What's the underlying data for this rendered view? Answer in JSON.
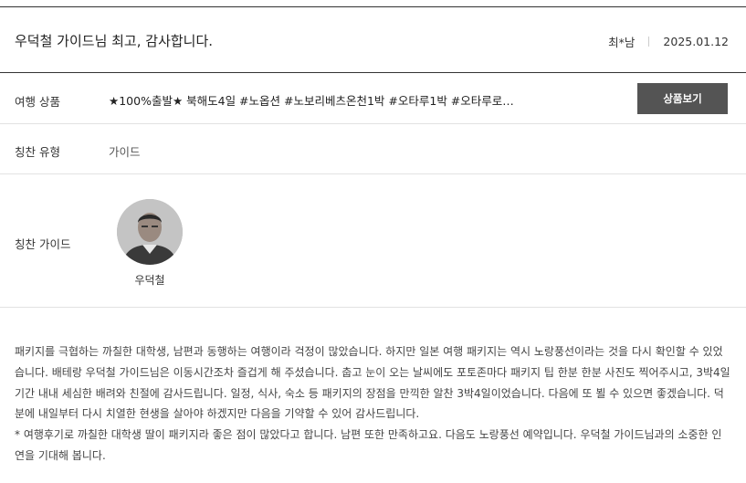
{
  "header": {
    "title": "우덕철 가이드님 최고, 감사합니다.",
    "author": "최*남",
    "date": "2025.01.12"
  },
  "product": {
    "label": "여행 상품",
    "value": "★100%출발★ 북해도4일 #노옵션 #노보리베츠온천1박 #오타루1박 #오타루로프...",
    "button_label": "상품보기"
  },
  "praise_type": {
    "label": "칭찬 유형",
    "value": "가이드"
  },
  "praise_guide": {
    "label": "칭찬 가이드",
    "guide_name": "우덕철"
  },
  "review": {
    "paragraph_1": "패키지를 극협하는 까칠한 대학생, 남편과 동행하는 여행이라 걱정이 많았습니다. 하지만 일본 여행 패키지는 역시 노랑풍선이라는 것을 다시 확인할 수 있었습니다. 배테랑 우덕철 가이드님은 이동시간조차 즐겁게 해 주셨습니다. 춥고 눈이 오는 날씨에도 포토존마다 패키지 팁 한분 한분 사진도 찍어주시고, 3박4일 기간 내내 세심한 배려와 친절에 감사드립니다. 일정, 식사, 숙소 등 패키지의 장점을 만끽한 알찬 3박4일이었습니다. 다음에 또 뵐 수 있으면 좋겠습니다. 덕분에 내일부터 다시 치열한 현생을 살아야 하겠지만 다음을 기약할 수 있어 감사드립니다.",
    "paragraph_2": "* 여행후기로 까칠한 대학생 딸이 패키지라 좋은 점이 많았다고 합니다. 남편 또한 만족하고요. 다음도 노랑풍선 예약입니다. 우덕철 가이드님과의 소중한 인연을 기대해 봅니다."
  },
  "colors": {
    "button_bg": "#545454",
    "border_dark": "#333333",
    "border_light": "#e2e2e2"
  }
}
